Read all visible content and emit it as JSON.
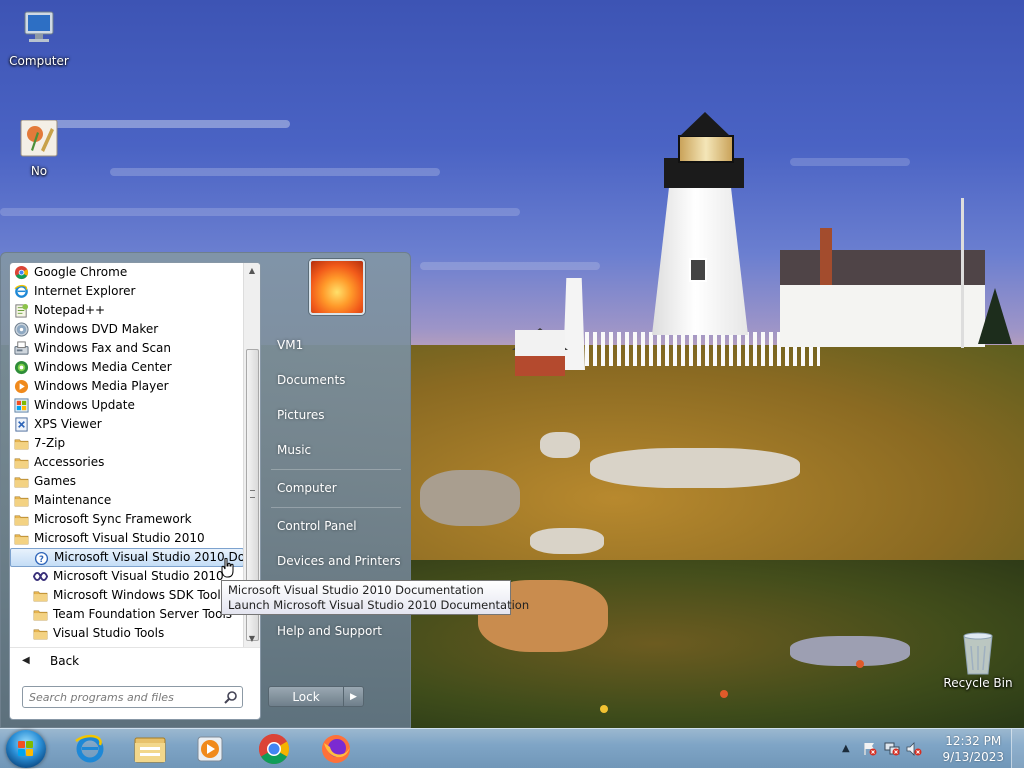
{
  "desktop": {
    "icons": [
      {
        "label": "Computer"
      },
      {
        "label": "No"
      },
      {
        "label": "Recycle Bin"
      }
    ]
  },
  "start_menu": {
    "programs": [
      {
        "label": "Google Chrome",
        "icon": "chrome-icon",
        "indent": false
      },
      {
        "label": "Internet Explorer",
        "icon": "ie-icon",
        "indent": false
      },
      {
        "label": "Notepad++",
        "icon": "notepadpp-icon",
        "indent": false
      },
      {
        "label": "Windows DVD Maker",
        "icon": "dvd-maker-icon",
        "indent": false
      },
      {
        "label": "Windows Fax and Scan",
        "icon": "fax-icon",
        "indent": false
      },
      {
        "label": "Windows Media Center",
        "icon": "media-center-icon",
        "indent": false
      },
      {
        "label": "Windows Media Player",
        "icon": "media-player-icon",
        "indent": false
      },
      {
        "label": "Windows Update",
        "icon": "windows-update-icon",
        "indent": false
      },
      {
        "label": "XPS Viewer",
        "icon": "xps-viewer-icon",
        "indent": false
      },
      {
        "label": "7-Zip",
        "icon": "folder-icon",
        "indent": false
      },
      {
        "label": "Accessories",
        "icon": "folder-icon",
        "indent": false
      },
      {
        "label": "Games",
        "icon": "folder-icon",
        "indent": false
      },
      {
        "label": "Maintenance",
        "icon": "folder-icon",
        "indent": false
      },
      {
        "label": "Microsoft Sync Framework",
        "icon": "folder-icon",
        "indent": false
      },
      {
        "label": "Microsoft Visual Studio 2010",
        "icon": "folder-icon",
        "indent": false
      },
      {
        "label": "Microsoft Visual Studio 2010 Documentation",
        "icon": "help-icon",
        "indent": true,
        "selected": true
      },
      {
        "label": "Microsoft Visual Studio 2010",
        "icon": "visual-studio-icon",
        "indent": true
      },
      {
        "label": "Microsoft Windows SDK Tools",
        "icon": "folder-icon",
        "indent": true
      },
      {
        "label": "Team Foundation Server Tools",
        "icon": "folder-icon",
        "indent": true
      },
      {
        "label": "Visual Studio Tools",
        "icon": "folder-icon",
        "indent": true
      }
    ],
    "back_label": "Back",
    "search_placeholder": "Search programs and files",
    "right_links": {
      "user": "VM1",
      "documents": "Documents",
      "pictures": "Pictures",
      "music": "Music",
      "computer": "Computer",
      "control_panel": "Control Panel",
      "devices_printers": "Devices and Printers",
      "help_support": "Help and Support"
    },
    "lock_label": "Lock"
  },
  "tooltip": {
    "line1": "Microsoft Visual Studio 2010 Documentation",
    "line2": "Launch Microsoft Visual Studio 2010 Documentation"
  },
  "taskbar": {
    "pinned": [
      "internet-explorer-icon",
      "explorer-icon",
      "media-player-icon",
      "chrome-icon",
      "firefox-icon"
    ],
    "clock_time": "12:32 PM",
    "clock_date": "9/13/2023"
  },
  "colors": {
    "taskbar": "#78a0c3",
    "selection": "#c4ddf6",
    "start_menu_glass": "#7c93a4"
  }
}
